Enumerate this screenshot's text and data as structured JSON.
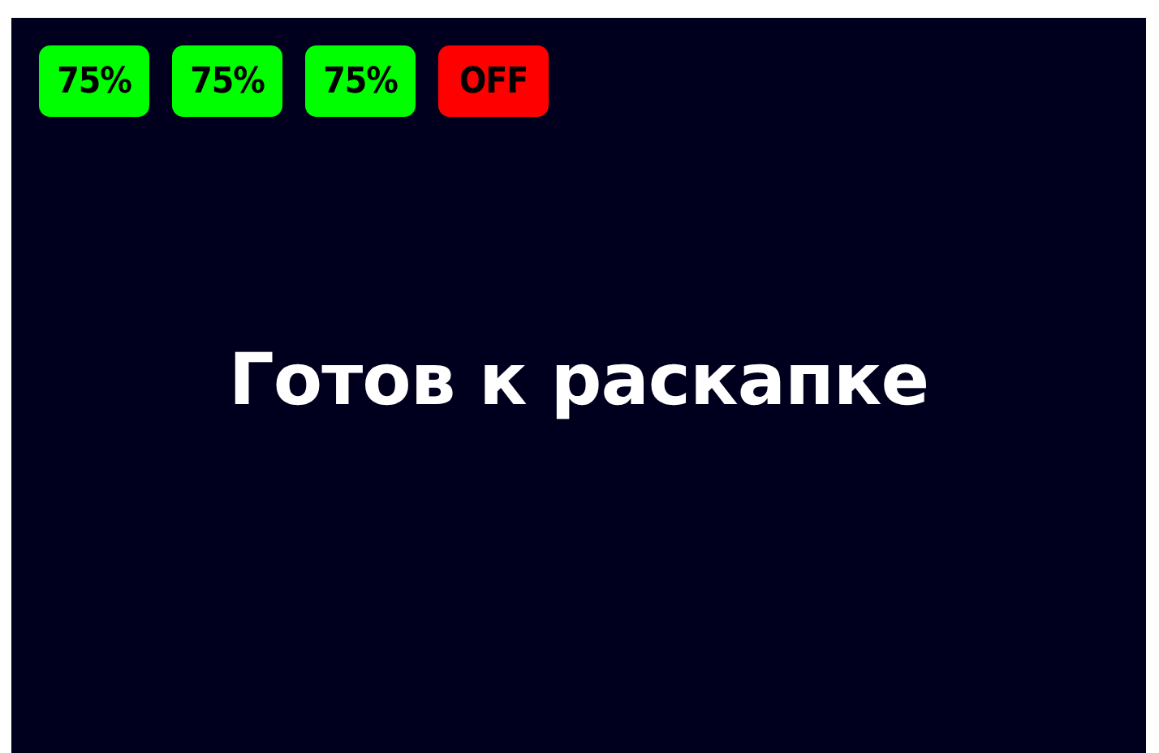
{
  "badges": [
    {
      "label": "75%",
      "color": "#00ff00"
    },
    {
      "label": "75%",
      "color": "#00ff00"
    },
    {
      "label": "75%",
      "color": "#00ff00"
    },
    {
      "label": "OFF",
      "color": "#ff0000"
    }
  ],
  "message": "Готов к раскапке"
}
